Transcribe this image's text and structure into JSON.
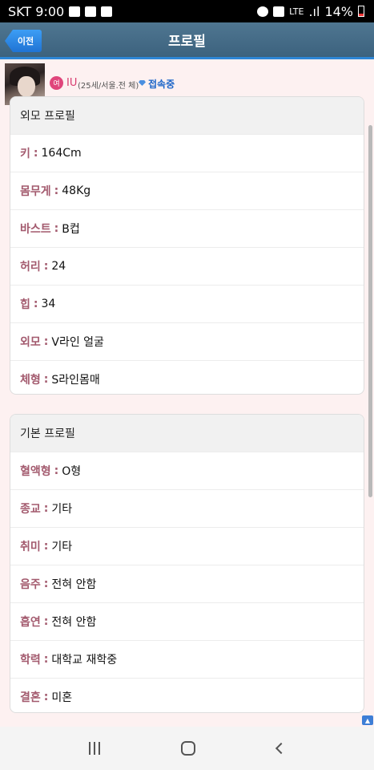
{
  "status_bar": {
    "carrier_time": "SKT 9:00",
    "network": "LTE",
    "battery": "14%"
  },
  "header": {
    "back_label": "이전",
    "title": "프로필"
  },
  "user": {
    "gender": "여",
    "name": "IU",
    "meta": "(25세/서울.전 체)",
    "status": "접속중"
  },
  "appearance": {
    "title": "외모 프로필",
    "rows": [
      {
        "label": "키",
        "value": "164Cm"
      },
      {
        "label": "몸무게",
        "value": "48Kg"
      },
      {
        "label": "바스트",
        "value": "B컵"
      },
      {
        "label": "허리",
        "value": "24"
      },
      {
        "label": "힙",
        "value": "34"
      },
      {
        "label": "외모",
        "value": "V라인 얼굴"
      },
      {
        "label": "체형",
        "value": "S라인몸매"
      }
    ]
  },
  "basic": {
    "title": "기본 프로필",
    "rows": [
      {
        "label": "혈액형",
        "value": "O형"
      },
      {
        "label": "종교",
        "value": "기타"
      },
      {
        "label": "취미",
        "value": "기타"
      },
      {
        "label": "음주",
        "value": "전혀 안함"
      },
      {
        "label": "흡연",
        "value": "전혀 안함"
      },
      {
        "label": "학력",
        "value": "대학교 재학중"
      },
      {
        "label": "결혼",
        "value": "미혼"
      }
    ]
  },
  "colors": {
    "header": "#3c627e",
    "accent": "#2d86d6",
    "label": "#a35a6e"
  }
}
